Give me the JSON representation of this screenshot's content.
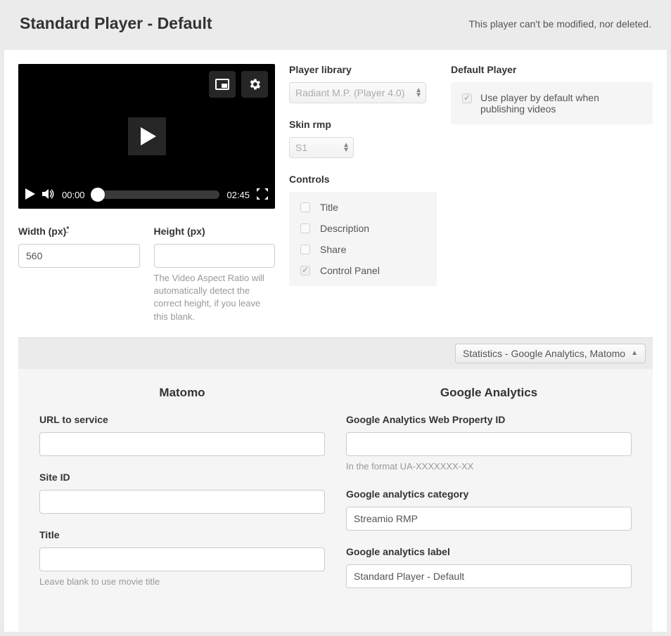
{
  "header": {
    "title": "Standard Player - Default",
    "note": "This player can't be modified, nor deleted."
  },
  "video": {
    "time_start": "00:00",
    "time_end": "02:45"
  },
  "dimensions": {
    "width_label": "Width (px)",
    "height_label": "Height (px)",
    "width_value": "560",
    "height_value": "",
    "height_help": "The Video Aspect Ratio will automatically detect the correct height, if you leave this blank."
  },
  "library": {
    "label": "Player library",
    "value": "Radiant M.P. (Player 4.0)"
  },
  "skin": {
    "label": "Skin rmp",
    "value": "S1"
  },
  "controls": {
    "label": "Controls",
    "items": [
      {
        "label": "Title"
      },
      {
        "label": "Description"
      },
      {
        "label": "Share"
      },
      {
        "label": "Control Panel"
      }
    ]
  },
  "default_player": {
    "label": "Default Player",
    "text": "Use player by default when publishing videos"
  },
  "stats": {
    "toggle": "Statistics - Google Analytics, Matomo",
    "matomo": {
      "heading": "Matomo",
      "url_label": "URL to service",
      "url_value": "",
      "siteid_label": "Site ID",
      "siteid_value": "",
      "title_label": "Title",
      "title_value": "",
      "title_help": "Leave blank to use movie title"
    },
    "ga": {
      "heading": "Google Analytics",
      "prop_label": "Google Analytics Web Property ID",
      "prop_value": "",
      "prop_help": "In the format UA-XXXXXXX-XX",
      "cat_label": "Google analytics category",
      "cat_value": "Streamio RMP",
      "label_label": "Google analytics label",
      "label_value": "Standard Player - Default"
    }
  }
}
